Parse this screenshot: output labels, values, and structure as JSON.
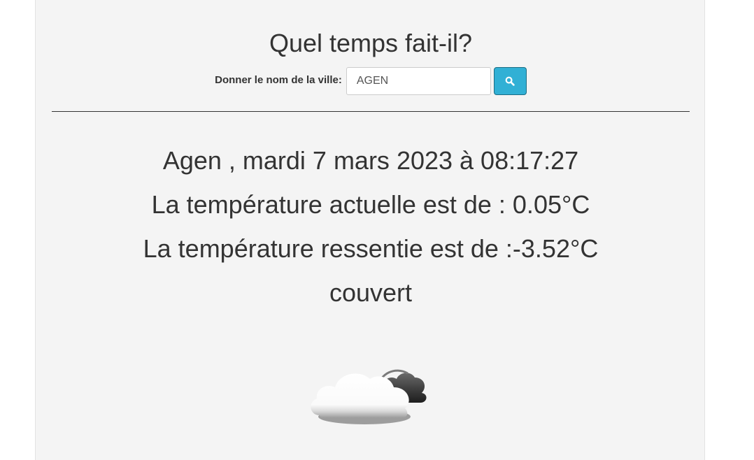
{
  "header": {
    "title": "Quel temps fait-il?"
  },
  "search": {
    "label": "Donner le nom de la ville:",
    "value": "AGEN",
    "button_icon": "search-icon"
  },
  "weather": {
    "date_line": "Agen , mardi 7 mars 2023 à 08:17:27",
    "current_temp_line": "La température actuelle est de : 0.05°C",
    "feels_like_line": "La température ressentie est de :-3.52°C",
    "description": "couvert",
    "icon": "overcast-clouds-icon"
  },
  "colors": {
    "panel_background": "#f4f4f4",
    "button_background": "#31b0d5",
    "text": "#333333"
  }
}
